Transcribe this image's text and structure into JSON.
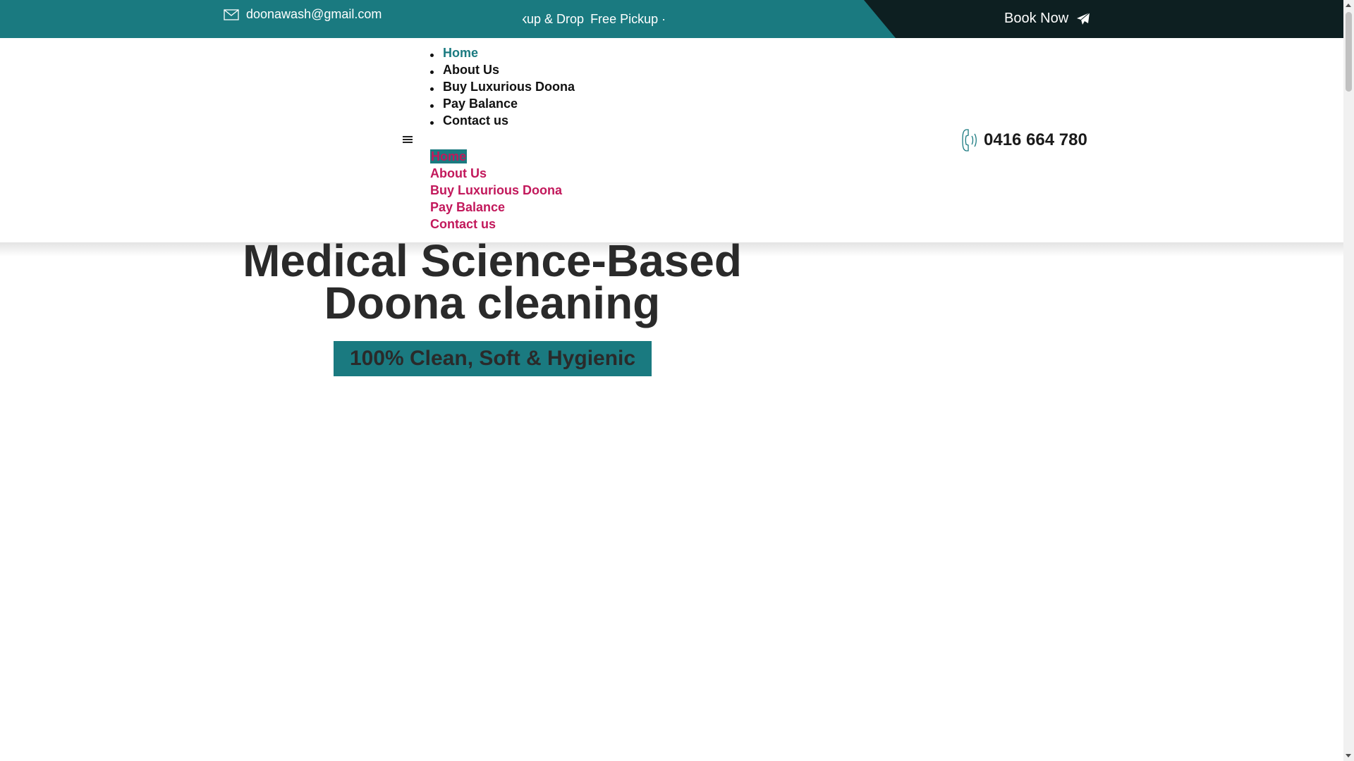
{
  "topbar": {
    "email": "doonawash@gmail.com",
    "ticker": [
      "ckup & Drop",
      "Free Pickup ·"
    ],
    "book_label": "Book Now"
  },
  "nav": {
    "items": [
      "Home",
      "About Us",
      "Buy Luxurious Doona",
      "Pay Balance",
      "Contact us"
    ]
  },
  "mobile_nav": {
    "items": [
      "Home",
      "About Us",
      "Buy Luxurious Doona",
      "Pay Balance",
      "Contact us"
    ]
  },
  "phone": "0416 664 780",
  "hero": {
    "title_line1": "Medical Science-Based",
    "title_line2": "Doona cleaning",
    "tagline": "100% Clean, Soft & Hygienic"
  },
  "colors": {
    "teal": "#1a7a80",
    "dark": "#0d1f21",
    "pink": "#c2185b"
  }
}
